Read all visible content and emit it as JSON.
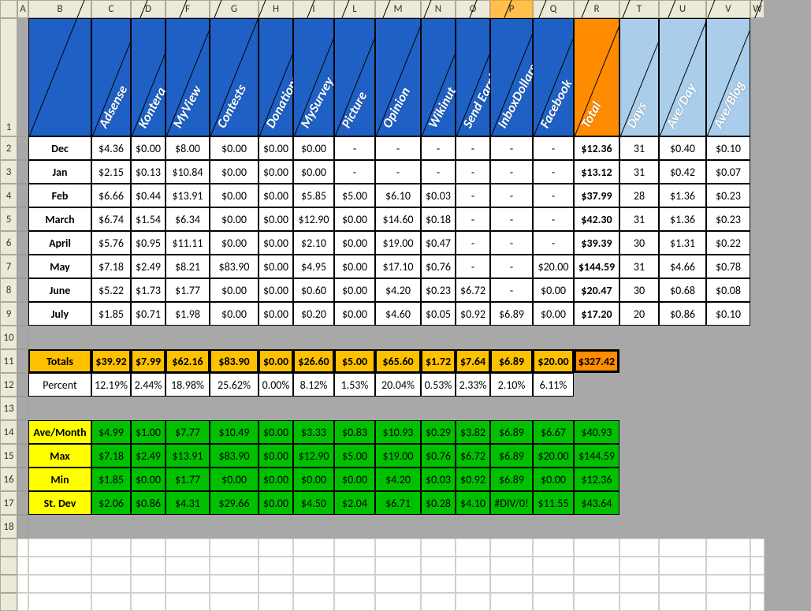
{
  "col_letters": [
    "A",
    "B",
    "C",
    "D",
    "F",
    "G",
    "H",
    "I",
    "L",
    "M",
    "N",
    "O",
    "P",
    "Q",
    "R",
    "T",
    "U",
    "V",
    "W"
  ],
  "selected_col": "P",
  "row_labels": [
    "1",
    "2",
    "3",
    "4",
    "5",
    "6",
    "7",
    "8",
    "9",
    "10",
    "11",
    "12",
    "13",
    "14",
    "15",
    "16",
    "17",
    "18"
  ],
  "headers": {
    "blue": [
      "Adsense",
      "Kontera",
      "MyView",
      "Contests",
      "Donations",
      "MySurvey",
      "Picture",
      "Opinion",
      "Wikinut",
      "Send Earnings",
      "InboxDollars",
      "Facebook"
    ],
    "orange": "Total",
    "ltblue": [
      "Days",
      "Ave/Day",
      "Ave/Blog"
    ]
  },
  "months": [
    "Dec",
    "Jan",
    "Feb",
    "March",
    "April",
    "May",
    "June",
    "July"
  ],
  "data": {
    "Dec": [
      "$4.36",
      "$0.00",
      "$8.00",
      "$0.00",
      "$0.00",
      "$0.00",
      "-",
      "-",
      "-",
      "-",
      "-",
      "-",
      "$12.36",
      "31",
      "$0.40",
      "$0.10"
    ],
    "Jan": [
      "$2.15",
      "$0.13",
      "$10.84",
      "$0.00",
      "$0.00",
      "$0.00",
      "-",
      "-",
      "-",
      "-",
      "-",
      "-",
      "$13.12",
      "31",
      "$0.42",
      "$0.07"
    ],
    "Feb": [
      "$6.66",
      "$0.44",
      "$13.91",
      "$0.00",
      "$0.00",
      "$5.85",
      "$5.00",
      "$6.10",
      "$0.03",
      "-",
      "-",
      "-",
      "$37.99",
      "28",
      "$1.36",
      "$0.23"
    ],
    "March": [
      "$6.74",
      "$1.54",
      "$6.34",
      "$0.00",
      "$0.00",
      "$12.90",
      "$0.00",
      "$14.60",
      "$0.18",
      "-",
      "-",
      "-",
      "$42.30",
      "31",
      "$1.36",
      "$0.23"
    ],
    "April": [
      "$5.76",
      "$0.95",
      "$11.11",
      "$0.00",
      "$0.00",
      "$2.10",
      "$0.00",
      "$19.00",
      "$0.47",
      "-",
      "-",
      "-",
      "$39.39",
      "30",
      "$1.31",
      "$0.22"
    ],
    "May": [
      "$7.18",
      "$2.49",
      "$8.21",
      "$83.90",
      "$0.00",
      "$4.95",
      "$0.00",
      "$17.10",
      "$0.76",
      "-",
      "-",
      "$20.00",
      "$144.59",
      "31",
      "$4.66",
      "$0.78"
    ],
    "June": [
      "$5.22",
      "$1.73",
      "$1.77",
      "$0.00",
      "$0.00",
      "$0.60",
      "$0.00",
      "$4.20",
      "$0.23",
      "$6.72",
      "-",
      "$0.00",
      "$20.47",
      "30",
      "$0.68",
      "$0.08"
    ],
    "July": [
      "$1.85",
      "$0.71",
      "$1.98",
      "$0.00",
      "$0.00",
      "$0.20",
      "$0.00",
      "$4.60",
      "$0.05",
      "$0.92",
      "$6.89",
      "$0.00",
      "$17.20",
      "20",
      "$0.86",
      "$0.10"
    ]
  },
  "totals_label": "Totals",
  "totals": [
    "$39.92",
    "$7.99",
    "$62.16",
    "$83.90",
    "$0.00",
    "$26.60",
    "$5.00",
    "$65.60",
    "$1.72",
    "$7.64",
    "$6.89",
    "$20.00",
    "$327.42"
  ],
  "percent_label": "Percent",
  "percent": [
    "12.19%",
    "2.44%",
    "18.98%",
    "25.62%",
    "0.00%",
    "8.12%",
    "1.53%",
    "20.04%",
    "0.53%",
    "2.33%",
    "2.10%",
    "6.11%"
  ],
  "stats_labels": [
    "Ave/Month",
    "Max",
    "Min",
    "St. Dev"
  ],
  "stats": {
    "Ave/Month": [
      "$4.99",
      "$1.00",
      "$7.77",
      "$10.49",
      "$0.00",
      "$3.33",
      "$0.83",
      "$10.93",
      "$0.29",
      "$3.82",
      "$6.89",
      "$6.67",
      "$40.93"
    ],
    "Max": [
      "$7.18",
      "$2.49",
      "$13.91",
      "$83.90",
      "$0.00",
      "$12.90",
      "$5.00",
      "$19.00",
      "$0.76",
      "$6.72",
      "$6.89",
      "$20.00",
      "$144.59"
    ],
    "Min": [
      "$1.85",
      "$0.00",
      "$1.77",
      "$0.00",
      "$0.00",
      "$0.00",
      "$0.00",
      "$4.20",
      "$0.03",
      "$0.92",
      "$6.89",
      "$0.00",
      "$12.36"
    ],
    "St. Dev": [
      "$2.06",
      "$0.86",
      "$4.31",
      "$29.66",
      "$0.00",
      "$4.50",
      "$2.04",
      "$6.71",
      "$0.28",
      "$4.10",
      "#DIV/0!",
      "$11.55",
      "$43.64"
    ]
  }
}
